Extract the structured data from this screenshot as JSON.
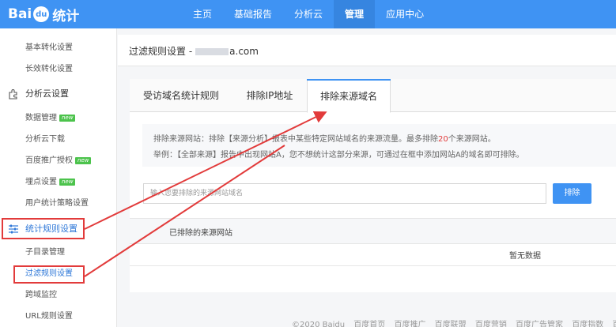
{
  "brand": {
    "logo_text": "Bai",
    "logo_paw": "du",
    "logo_suffix": "统计"
  },
  "topnav": [
    {
      "label": "主页"
    },
    {
      "label": "基础报告"
    },
    {
      "label": "分析云"
    },
    {
      "label": "管理",
      "active": true
    },
    {
      "label": "应用中心"
    }
  ],
  "sidebar": {
    "items": [
      {
        "label": "基本转化设置"
      },
      {
        "label": "长效转化设置"
      },
      {
        "label": "分析云设置",
        "group": true,
        "icon": "puzzle-icon"
      },
      {
        "label": "数据管理",
        "badge": "new"
      },
      {
        "label": "分析云下载"
      },
      {
        "label": "百度推广授权",
        "badge": "new"
      },
      {
        "label": "埋点设置",
        "badge": "new"
      },
      {
        "label": "用户统计策略设置"
      },
      {
        "label": "统计规则设置",
        "group": true,
        "icon": "sliders-icon"
      },
      {
        "label": "子目录管理"
      },
      {
        "label": "过滤规则设置"
      },
      {
        "label": "跨域监控"
      },
      {
        "label": "URL规则设置"
      }
    ]
  },
  "header": {
    "title_prefix": "过滤规则设置 -",
    "title_domain": "a.com"
  },
  "tabs": [
    {
      "label": "受访域名统计规则"
    },
    {
      "label": "排除IP地址"
    },
    {
      "label": "排除来源域名",
      "active": true
    }
  ],
  "description": {
    "line1_a": "排除来源网站：排除【来源分析】报表中某些特定网站域名的来源流量。最多排除",
    "line1_num": "20",
    "line1_b": "个来源网站。",
    "line2": "举例：【全部来源】报告中出现网站A，您不想统计这部分来源，可通过在框中添加网站A的域名即可排除。"
  },
  "input": {
    "placeholder": "输入您要排除的来源网站域名"
  },
  "button": {
    "label": "排除"
  },
  "list": {
    "header": "已排除的来源网站",
    "empty": "暂无数据"
  },
  "footer": [
    "©2020 Baidu",
    "百度首页",
    "百度推广",
    "百度联盟",
    "百度营销",
    "百度广告管家",
    "百度指数",
    "百"
  ],
  "colors": {
    "brand_blue": "#3f93f3",
    "highlight_red": "#e23b3b",
    "badge_green": "#4cc34c"
  }
}
